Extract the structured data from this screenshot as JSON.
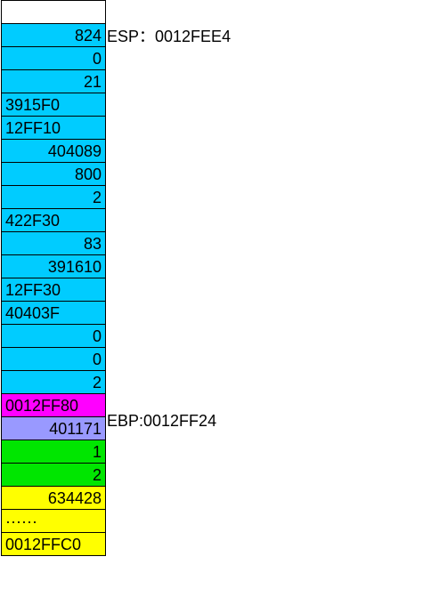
{
  "stack": {
    "cells": [
      {
        "value": "",
        "color": "white",
        "align": "right"
      },
      {
        "value": "824",
        "color": "cyan",
        "align": "right"
      },
      {
        "value": "0",
        "color": "cyan",
        "align": "right"
      },
      {
        "value": "21",
        "color": "cyan",
        "align": "right"
      },
      {
        "value": "3915F0",
        "color": "cyan",
        "align": "left"
      },
      {
        "value": "12FF10",
        "color": "cyan",
        "align": "left"
      },
      {
        "value": "404089",
        "color": "cyan",
        "align": "right"
      },
      {
        "value": "800",
        "color": "cyan",
        "align": "right"
      },
      {
        "value": "2",
        "color": "cyan",
        "align": "right"
      },
      {
        "value": "422F30",
        "color": "cyan",
        "align": "left"
      },
      {
        "value": "83",
        "color": "cyan",
        "align": "right"
      },
      {
        "value": "391610",
        "color": "cyan",
        "align": "right"
      },
      {
        "value": "12FF30",
        "color": "cyan",
        "align": "left"
      },
      {
        "value": "40403F",
        "color": "cyan",
        "align": "left"
      },
      {
        "value": "0",
        "color": "cyan",
        "align": "right"
      },
      {
        "value": "0",
        "color": "cyan",
        "align": "right"
      },
      {
        "value": "2",
        "color": "cyan",
        "align": "right"
      },
      {
        "value": "0012FF80",
        "color": "magenta",
        "align": "left"
      },
      {
        "value": "401171",
        "color": "violet",
        "align": "right"
      },
      {
        "value": "1",
        "color": "green",
        "align": "right"
      },
      {
        "value": "2",
        "color": "green",
        "align": "right"
      },
      {
        "value": "634428",
        "color": "yellow",
        "align": "right"
      },
      {
        "value": "······",
        "color": "yellow",
        "align": "left"
      },
      {
        "value": "0012FFC0",
        "color": "yellow",
        "align": "left"
      }
    ]
  },
  "labels": {
    "esp": {
      "text": "ESP：0012FEE4",
      "row": 1
    },
    "ebp": {
      "text": "EBP:0012FF24",
      "row": 17
    }
  }
}
